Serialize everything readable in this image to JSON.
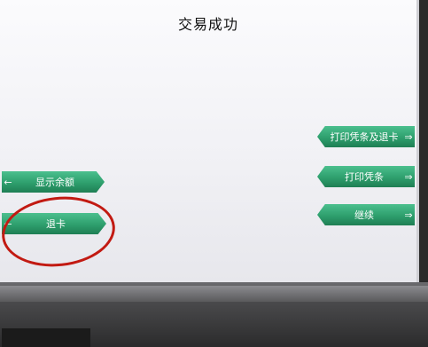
{
  "screen": {
    "title": "交易成功"
  },
  "buttons": {
    "show_balance": "显示余额",
    "eject_card": "退卡",
    "print_receipt_and_exit": "打印凭条及退卡",
    "print_receipt": "打印凭条",
    "continue": "继续"
  },
  "icons": {
    "left_arrow": "←",
    "right_arrow": "⇒"
  },
  "colors": {
    "button_green": "#2e9f6d",
    "annotation_red": "#c21a12"
  }
}
